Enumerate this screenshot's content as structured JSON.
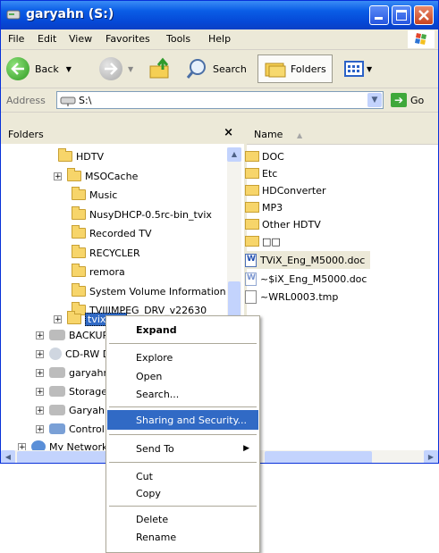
{
  "window": {
    "title": "garyahn (S:)",
    "menu": [
      "File",
      "Edit",
      "View",
      "Favorites",
      "Tools",
      "Help"
    ],
    "toolbar": {
      "back": "Back",
      "search": "Search",
      "folders": "Folders"
    },
    "address": {
      "label": "Address",
      "value": "S:\\",
      "go": "Go"
    }
  },
  "folders_pane": {
    "title": "Folders",
    "close": "×",
    "items": [
      {
        "label": "HDTV"
      },
      {
        "label": "MSOCache"
      },
      {
        "label": "Music"
      },
      {
        "label": "NusyDHCP-0.5rc-bin_tvix"
      },
      {
        "label": "Recorded TV"
      },
      {
        "label": "RECYCLER"
      },
      {
        "label": "remora"
      },
      {
        "label": "System Volume Information"
      },
      {
        "label": "TVIIIMPEG_DRV_v22630"
      },
      {
        "label": "tvixhd1"
      },
      {
        "label": "BACKUP"
      },
      {
        "label": "CD-RW D"
      },
      {
        "label": "garyahn"
      },
      {
        "label": "Storage"
      },
      {
        "label": "Garyahn"
      },
      {
        "label": "Control P"
      },
      {
        "label": "My Network P"
      }
    ]
  },
  "file_list": {
    "column": "Name",
    "items": [
      {
        "label": "DOC"
      },
      {
        "label": "Etc"
      },
      {
        "label": "HDConverter"
      },
      {
        "label": "MP3"
      },
      {
        "label": "Other HDTV"
      },
      {
        "label": "□□"
      },
      {
        "label": "TViX_Eng_M5000.doc"
      },
      {
        "label": "~$iX_Eng_M5000.doc"
      },
      {
        "label": "~WRL0003.tmp"
      }
    ]
  },
  "context_menu": {
    "expand": "Expand",
    "explore": "Explore",
    "open": "Open",
    "search": "Search...",
    "sharing": "Sharing and Security...",
    "send_to": "Send To",
    "cut": "Cut",
    "copy": "Copy",
    "delete": "Delete",
    "rename": "Rename"
  }
}
